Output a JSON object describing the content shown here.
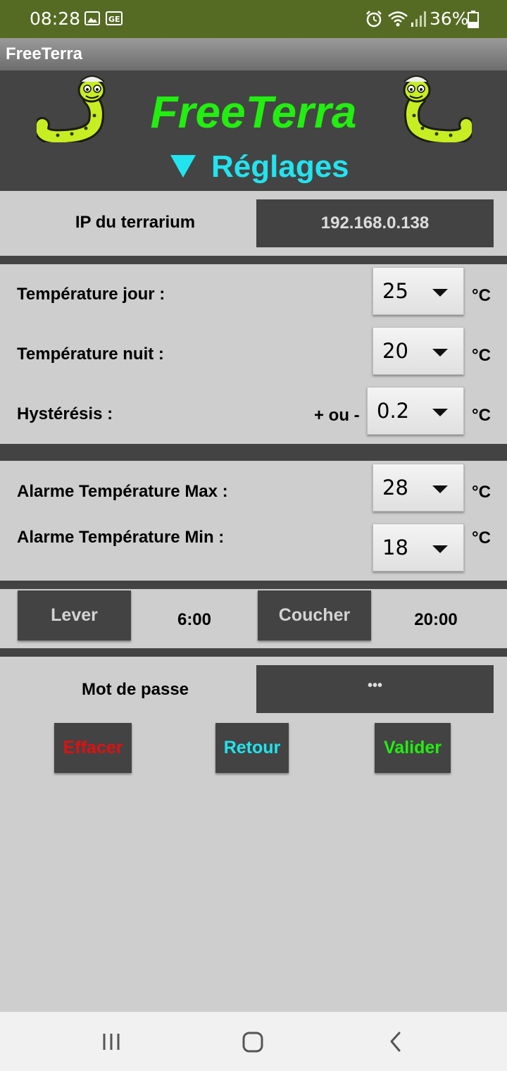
{
  "status_bar": {
    "time": "08:28",
    "battery": "36%",
    "icons": [
      "gallery-icon",
      "sim-icon",
      "alarm-icon",
      "wifi-icon",
      "signal-icon",
      "battery-icon"
    ]
  },
  "app_bar": {
    "title": "FreeTerra"
  },
  "header": {
    "brand": "FreeTerra",
    "section": "Réglages",
    "brand_color": "#22ee10",
    "section_color": "#22e4ee"
  },
  "ip": {
    "label": "IP du terrarium",
    "value": "192.168.0.138"
  },
  "temperatures": {
    "day": {
      "label": "Température jour :",
      "value": "25",
      "unit": "°C"
    },
    "night": {
      "label": "Température nuit :",
      "value": "20",
      "unit": "°C"
    },
    "hysteresis": {
      "label": "Hystérésis :",
      "prefix": "+ ou -",
      "value": "0.2",
      "unit": "°C"
    }
  },
  "alarms": {
    "max": {
      "label": "Alarme Température Max :",
      "value": "28",
      "unit": "°C"
    },
    "min": {
      "label": "Alarme Température Min :",
      "value": "18",
      "unit": "°C"
    }
  },
  "schedule": {
    "sunrise_label": "Lever",
    "sunrise_time": "6:00",
    "sunset_label": "Coucher",
    "sunset_time": "20:00"
  },
  "password": {
    "label": "Mot de passe",
    "value": "•••"
  },
  "actions": {
    "clear": "Effacer",
    "clear_color": "#e21010",
    "back": "Retour",
    "back_color": "#22e4ee",
    "submit": "Valider",
    "submit_color": "#22ee10"
  },
  "nav": {
    "icons": [
      "recent-apps-icon",
      "home-icon",
      "back-icon"
    ]
  }
}
